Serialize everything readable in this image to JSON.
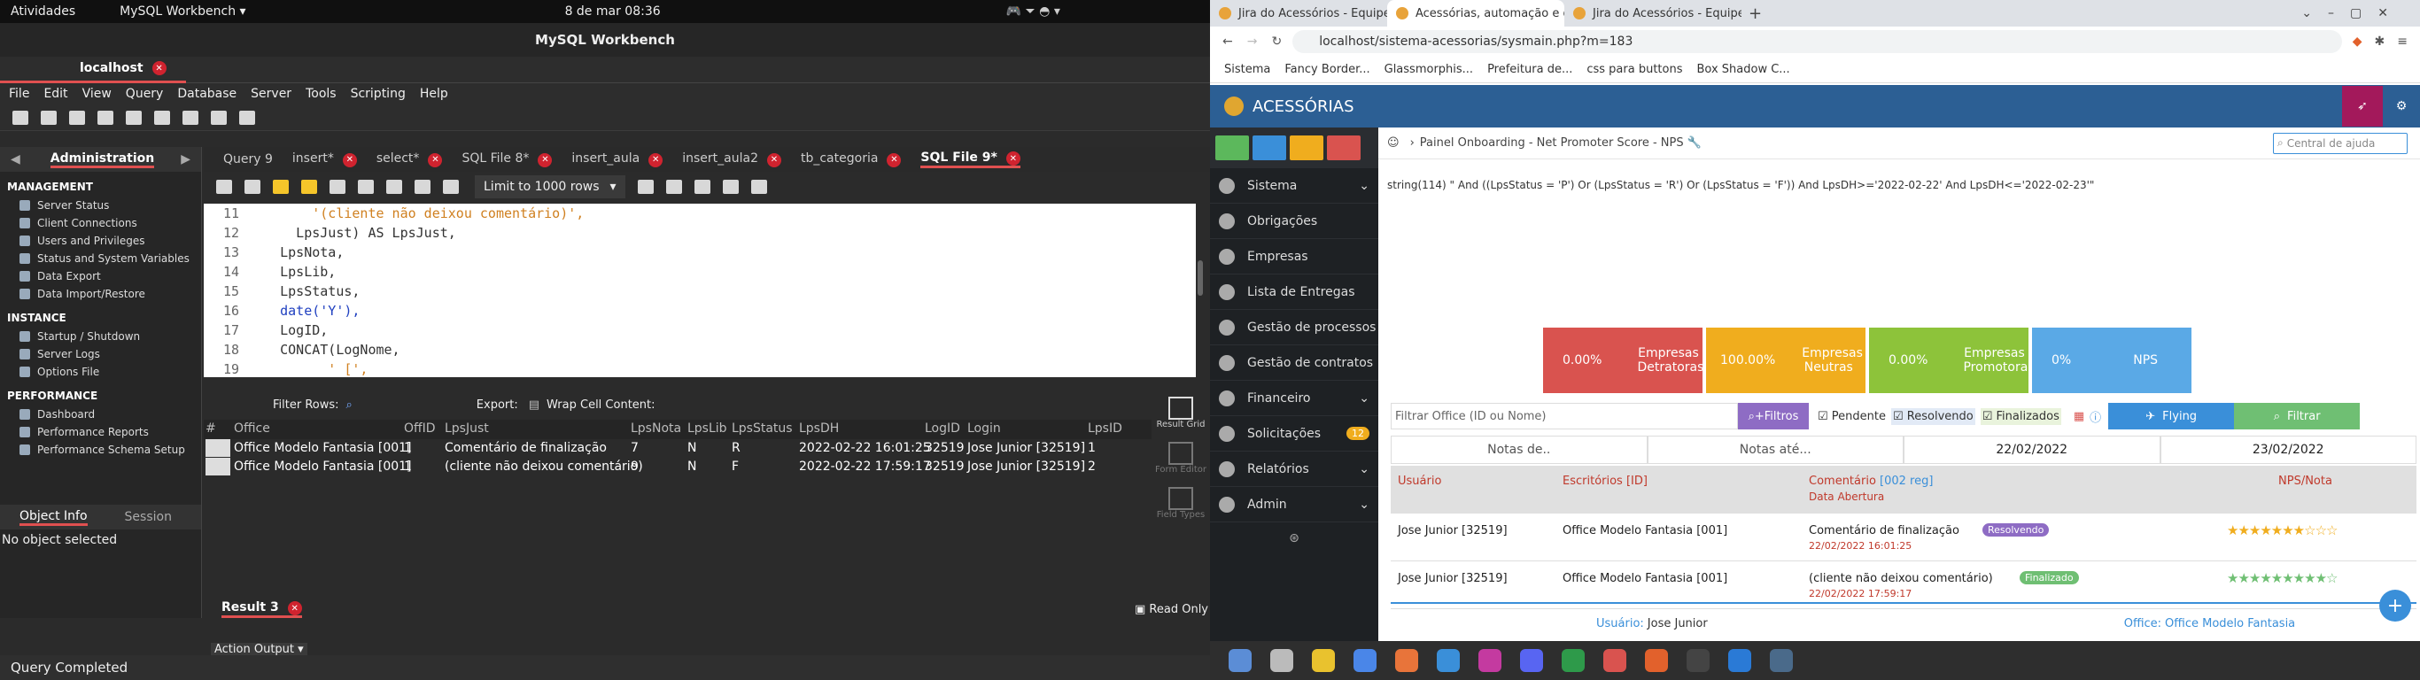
{
  "gnome": {
    "activities": "Atividades",
    "app": "MySQL Workbench ▾",
    "clock": "8 de mar  08:36"
  },
  "workbench": {
    "title": "MySQL Workbench",
    "connection_tab": "localhost",
    "menu": [
      "File",
      "Edit",
      "View",
      "Query",
      "Database",
      "Server",
      "Tools",
      "Scripting",
      "Help"
    ],
    "admin_header": "Administration",
    "sections": {
      "management": "MANAGEMENT",
      "management_items": [
        "Server Status",
        "Client Connections",
        "Users and Privileges",
        "Status and System Variables",
        "Data Export",
        "Data Import/Restore"
      ],
      "instance": "INSTANCE",
      "instance_items": [
        "Startup / Shutdown",
        "Server Logs",
        "Options File"
      ],
      "performance": "PERFORMANCE",
      "performance_items": [
        "Dashboard",
        "Performance Reports",
        "Performance Schema Setup"
      ]
    },
    "object_info": "Object Info",
    "session": "Session",
    "no_object": "No object selected",
    "editor_tabs": [
      "Query 9",
      "insert*",
      "select*",
      "SQL File 8*",
      "insert_aula",
      "insert_aula2",
      "tb_categoria",
      "SQL File 9*"
    ],
    "limit": "Limit to 1000 rows",
    "code_lines": [
      {
        "n": "11",
        "t": "        '(cliente não deixou comentário)',"
      },
      {
        "n": "12",
        "t": "      LpsJust) AS LpsJust,"
      },
      {
        "n": "13",
        "t": "    LpsNota,"
      },
      {
        "n": "14",
        "t": "    LpsLib,"
      },
      {
        "n": "15",
        "t": "    LpsStatus,"
      },
      {
        "n": "16",
        "t": "    date('Y'),"
      },
      {
        "n": "17",
        "t": "    LogID,"
      },
      {
        "n": "18",
        "t": "    CONCAT(LogNome,"
      },
      {
        "n": "19",
        "t": "          ' [',"
      }
    ],
    "filter_rows": "Filter Rows:",
    "export": "Export:",
    "wrap": "Wrap Cell Content:",
    "columns": [
      "#",
      "Office",
      "OffID",
      "LpsJust",
      "LpsNota",
      "LpsLib",
      "LpsStatus",
      "LpsDH",
      "LogID",
      "Login",
      "LpsID"
    ],
    "rows": [
      [
        "",
        "Office Modelo Fantasia [001]",
        "1",
        "Comentário de finalização",
        "7",
        "N",
        "R",
        "2022-02-22 16:01:25",
        "32519",
        "Jose Junior [32519]",
        "1"
      ],
      [
        "",
        "Office Modelo Fantasia [001]",
        "1",
        "(cliente não deixou comentário)",
        "9",
        "N",
        "F",
        "2022-02-22 17:59:17",
        "32519",
        "Jose Junior [32519]",
        "2"
      ]
    ],
    "side_buttons": [
      "Result Grid",
      "Form Editor",
      "Field Types"
    ],
    "result_tab": "Result 3",
    "read_only": "Read Only",
    "action_output": "Action Output ▾",
    "status": "Query Completed"
  },
  "browser": {
    "tabs": [
      "Jira do Acessórios - Equipe ág",
      "Acessórias, automação e g",
      "Jira do Acessórios - Equipe ág"
    ],
    "url": "localhost/sistema-acessorias/sysmain.php?m=183",
    "bookmarks": [
      "Sistema",
      "Fancy Border...",
      "Glassmorphis...",
      "Prefeitura de...",
      "css para buttons",
      "Box Shadow C..."
    ],
    "brand": "ACESSÓRIAS",
    "breadcrumb": "Painel Onboarding - Net Promoter Score - NPS",
    "help_placeholder": "Central de ajuda",
    "sql_debug": "string(114) \" And ((LpsStatus = 'P') Or (LpsStatus = 'R') Or (LpsStatus = 'F')) And LpsDH>='2022-02-22' And LpsDH<='2022-02-23'\"",
    "side_menu": [
      "Sistema",
      "Obrigações",
      "Empresas",
      "Lista de Entregas",
      "Gestão de processos",
      "Gestão de contratos",
      "Financeiro",
      "Solicitações",
      "Relatórios",
      "Admin"
    ],
    "solicitacoes_badge": "12",
    "kpis": [
      {
        "value": "0.00%",
        "label": "Empresas Detratoras",
        "color": "#d9534f"
      },
      {
        "value": "100.00%",
        "label": "Empresas Neutras",
        "color": "#f0ad1e"
      },
      {
        "value": "0.00%",
        "label": "Empresas Promotoras",
        "color": "#8dc33a"
      },
      {
        "value": "0%",
        "label": "NPS",
        "color": "#5aa9e6"
      }
    ],
    "filter_office_placeholder": "Filtrar Office (ID ou Nome)",
    "more_filters": "+Filtros",
    "checks": [
      "Pendente",
      "Resolvendo",
      "Finalizados"
    ],
    "flying": "Flying",
    "filtrar": "Filtrar",
    "notes_from": "Notas de..",
    "notes_to": "Notas até...",
    "date_from": "22/02/2022",
    "date_to": "23/02/2022",
    "table_headers": {
      "user": "Usuário",
      "office": "Escritórios [ID]",
      "comment": "Comentário",
      "reg": "[002 reg]",
      "date_open": "Data Abertura",
      "nps": "NPS/Nota"
    },
    "rows": [
      {
        "user": "Jose Junior [32519]",
        "office": "Office Modelo Fantasia [001]",
        "comment": "Comentário de finalização",
        "badge": "Resolvendo",
        "date": "22/02/2022 16:01:25",
        "stars": 7
      },
      {
        "user": "Jose Junior [32519]",
        "office": "Office Modelo Fantasia [001]",
        "comment": "(cliente não deixou comentário)",
        "badge": "Finalizado",
        "date": "22/02/2022 17:59:17",
        "stars": 9
      }
    ],
    "footer_user_label": "Usuário:",
    "footer_user": "Jose Junior",
    "footer_office_label": "Office:",
    "footer_office": "Office Modelo Fantasia"
  }
}
